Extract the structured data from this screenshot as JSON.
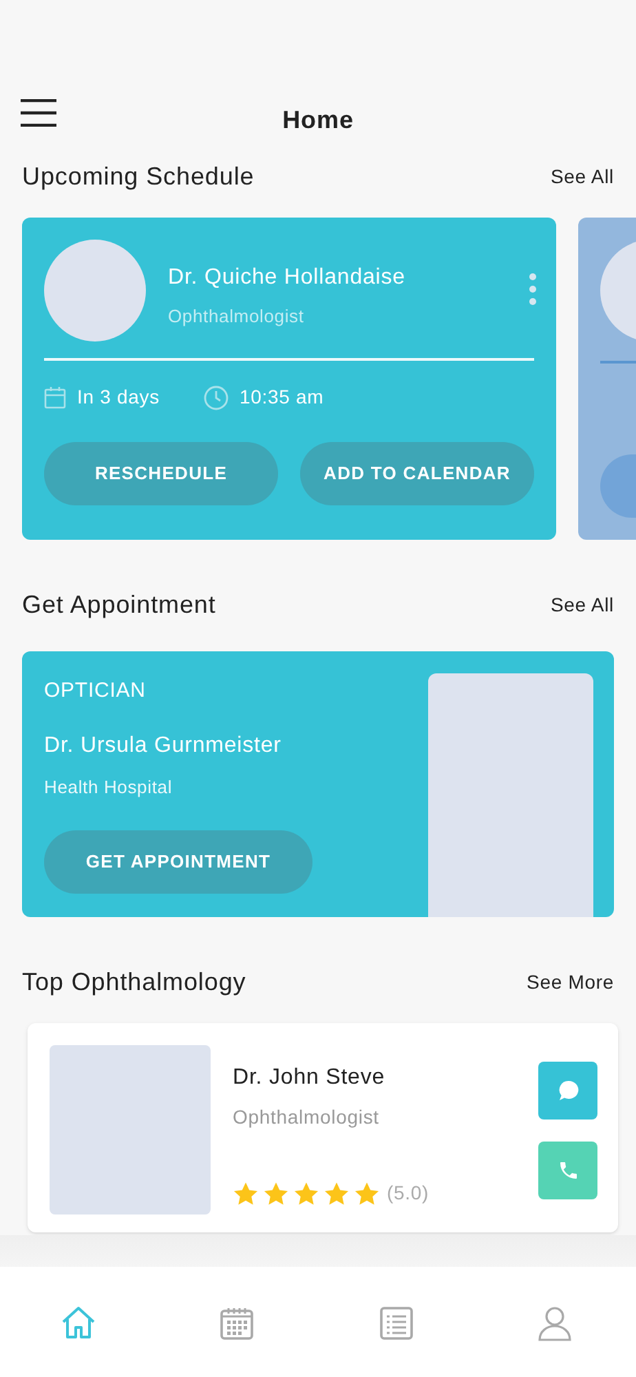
{
  "header": {
    "title": "Home"
  },
  "upcoming": {
    "title": "Upcoming Schedule",
    "link": "See All",
    "cards": [
      {
        "name": "Dr. Quiche Hollandaise",
        "specialty": "Ophthalmologist",
        "date": "In 3 days",
        "time": "10:35 am",
        "buttons": [
          "RESCHEDULE",
          "ADD TO CALENDAR"
        ]
      }
    ]
  },
  "appointment": {
    "title": "Get Appointment",
    "link": "See All",
    "category": "OPTICIAN",
    "name": "Dr. Ursula Gurnmeister",
    "hospital": "Health Hospital",
    "button": "GET APPOINTMENT"
  },
  "top": {
    "title": "Top Ophthalmology",
    "link": "See More",
    "doctors": [
      {
        "name": "Dr. John Steve",
        "specialty": "Ophthalmologist",
        "stars": 5,
        "rating": "(5.0)"
      }
    ]
  },
  "nav": [
    {
      "kind": "home",
      "selected": true
    },
    {
      "kind": "calendar",
      "selected": false
    },
    {
      "kind": "list",
      "selected": false
    },
    {
      "kind": "profile",
      "selected": false
    }
  ]
}
